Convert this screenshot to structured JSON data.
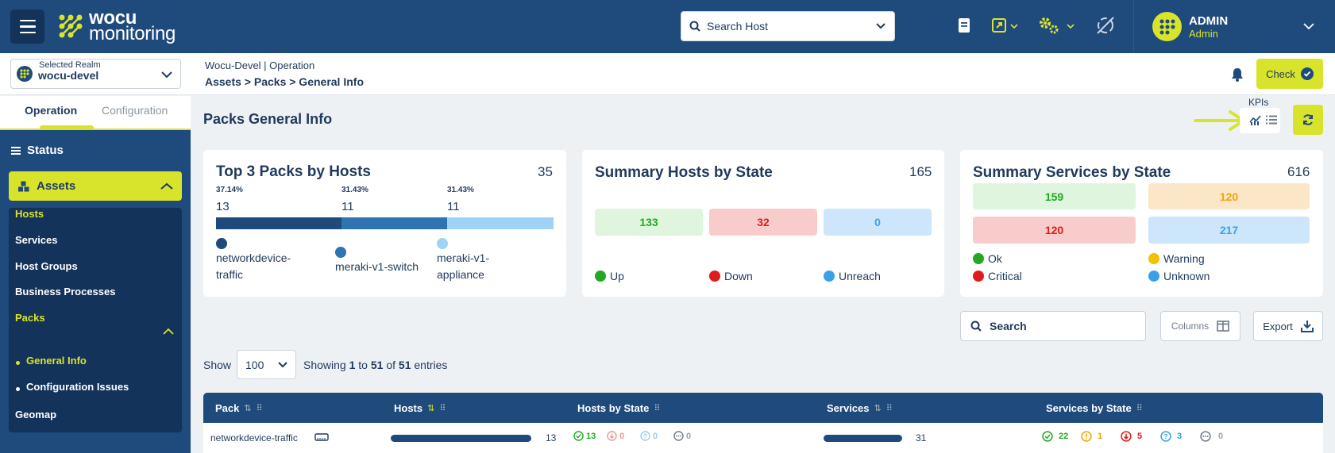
{
  "app": {
    "logo_line1": "wocu",
    "logo_line2": "monitoring"
  },
  "header": {
    "search_placeholder": "Search Host",
    "admin_name": "ADMIN",
    "admin_role": "Admin"
  },
  "realm": {
    "label": "Selected Realm",
    "value": "wocu-devel"
  },
  "breadcrumb": {
    "line1": "Wocu-Devel | Operation",
    "line2": "Assets > Packs > General Info"
  },
  "check_label": "Check",
  "sidebar": {
    "tabs": [
      "Operation",
      "Configuration"
    ],
    "status": "Status",
    "assets": "Assets",
    "items": [
      "Hosts",
      "Services",
      "Host Groups",
      "Business Processes",
      "Packs",
      "General Info",
      "Configuration Issues",
      "Geomap"
    ]
  },
  "main": {
    "title": "Packs General Info",
    "kpis_label": "KPIs"
  },
  "cards": {
    "top_packs": {
      "title": "Top 3 Packs by Hosts",
      "total": "35",
      "packs": [
        {
          "pct": "37.14%",
          "count": "13",
          "label1": "networkdevice-",
          "label2": "traffic",
          "color": "#1e4a7c"
        },
        {
          "pct": "31.43%",
          "count": "11",
          "label1": "meraki-v1-switch",
          "label2": "",
          "color": "#2f74b0"
        },
        {
          "pct": "31.43%",
          "count": "11",
          "label1": "meraki-v1-",
          "label2": "appliance",
          "color": "#9fd3f5"
        }
      ]
    },
    "hosts": {
      "title": "Summary Hosts by State",
      "total": "165",
      "states": [
        {
          "value": "133",
          "label": "Up",
          "color": "#22a822"
        },
        {
          "value": "32",
          "label": "Down",
          "color": "#e01b1b"
        },
        {
          "value": "0",
          "label": "Unreach",
          "color": "#3aa0e8"
        }
      ]
    },
    "services": {
      "title": "Summary Services by State",
      "total": "616",
      "states": [
        {
          "value": "159",
          "label": "Ok",
          "color": "#22a822"
        },
        {
          "value": "120",
          "label": "Warning",
          "color": "#f2c200"
        },
        {
          "value": "120",
          "label": "Critical",
          "color": "#e01b1b"
        },
        {
          "value": "217",
          "label": "Unknown",
          "color": "#3aa0e8"
        }
      ]
    }
  },
  "controls": {
    "search": "Search",
    "columns": "Columns",
    "export": "Export",
    "show": "Show",
    "show_value": "100",
    "showing_pre": "Showing ",
    "from": "1",
    "to_word": " to ",
    "to": "51",
    "of_word": " of ",
    "total": "51",
    "entries": " entries"
  },
  "table": {
    "headers": [
      "Pack",
      "Hosts",
      "Hosts by State",
      "Services",
      "Services by State"
    ],
    "rows": [
      {
        "pack": "networkdevice-traffic",
        "hosts": "13",
        "hosts_fill": 1.0,
        "h_up": "13",
        "h_down": "0",
        "h_unreach": "0",
        "h_pending": "0",
        "services": "31",
        "services_fill": 1.0,
        "s_ok": "22",
        "s_warn": "1",
        "s_crit": "5",
        "s_unk": "3",
        "s_pend": "0"
      }
    ]
  }
}
